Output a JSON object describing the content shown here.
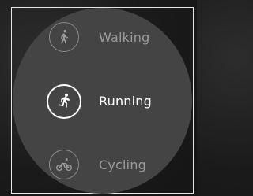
{
  "activities": [
    {
      "label": "Walking",
      "icon": "walking-icon",
      "selected": false
    },
    {
      "label": "Running",
      "icon": "running-icon",
      "selected": true
    },
    {
      "label": "Cycling",
      "icon": "cycling-icon",
      "selected": false
    }
  ],
  "colors": {
    "background": "#1a1a1a",
    "watch_face": "#444444",
    "selected_text": "#ffffff",
    "unselected_text": "#9a9a9a",
    "frame": "#e6e6e6"
  }
}
